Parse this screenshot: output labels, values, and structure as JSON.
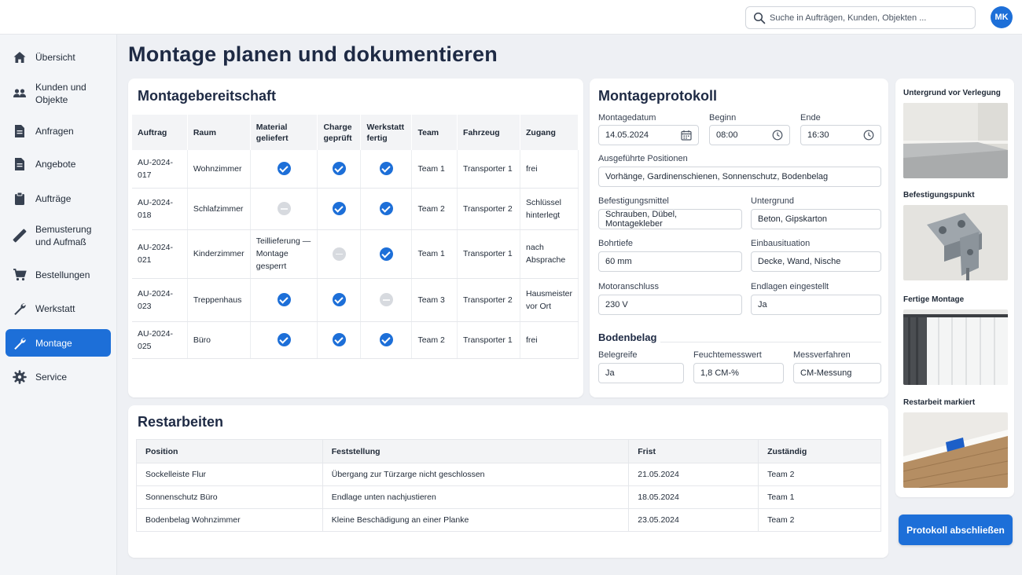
{
  "search": {
    "placeholder": "Suche in Aufträgen, Kunden, Objekten ..."
  },
  "user": {
    "initials": "MK"
  },
  "sidebar": {
    "items": [
      {
        "label": "Übersicht",
        "icon": "home-icon"
      },
      {
        "label": "Kunden und Objekte",
        "icon": "users-icon"
      },
      {
        "label": "Anfragen",
        "icon": "document-icon"
      },
      {
        "label": "Angebote",
        "icon": "document-icon"
      },
      {
        "label": "Aufträge",
        "icon": "clipboard-icon"
      },
      {
        "label": "Bemusterung und Aufmaß",
        "icon": "ruler-icon"
      },
      {
        "label": "Bestellungen",
        "icon": "cart-icon"
      },
      {
        "label": "Werkstatt",
        "icon": "wrench-icon"
      },
      {
        "label": "Montage",
        "icon": "wrench-icon",
        "active": true
      },
      {
        "label": "Service",
        "icon": "gear-icon"
      }
    ]
  },
  "page": {
    "title": "Montage planen und dokumentieren"
  },
  "readiness": {
    "title": "Montagebereitschaft",
    "columns": [
      "Auftrag",
      "Raum",
      "Material geliefert",
      "Charge geprüft",
      "Werkstatt fertig",
      "Team",
      "Fahrzeug",
      "Zugang"
    ],
    "rows": [
      {
        "auftrag": "AU-2024-017",
        "raum": "Wohnzimmer",
        "material": "check",
        "material_text": "",
        "charge": "check",
        "werkstatt": "check",
        "team": "Team 1",
        "fahrzeug": "Transporter 1",
        "zugang": "frei"
      },
      {
        "auftrag": "AU-2024-018",
        "raum": "Schlafzimmer",
        "material": "pending",
        "material_text": "",
        "charge": "check",
        "werkstatt": "check",
        "team": "Team 2",
        "fahrzeug": "Transporter 2",
        "zugang": "Schlüssel hinterlegt"
      },
      {
        "auftrag": "AU-2024-021",
        "raum": "Kinderzimmer",
        "material": "text",
        "material_text": "Teillieferung — Montage gesperrt",
        "charge": "pending",
        "werkstatt": "check",
        "team": "Team 1",
        "fahrzeug": "Transporter 1",
        "zugang": "nach Absprache"
      },
      {
        "auftrag": "AU-2024-023",
        "raum": "Treppenhaus",
        "material": "check",
        "material_text": "",
        "charge": "check",
        "werkstatt": "pending",
        "team": "Team 3",
        "fahrzeug": "Transporter 2",
        "zugang": "Hausmeister vor Ort"
      },
      {
        "auftrag": "AU-2024-025",
        "raum": "Büro",
        "material": "check",
        "material_text": "",
        "charge": "check",
        "werkstatt": "check",
        "team": "Team 2",
        "fahrzeug": "Transporter 1",
        "zugang": "frei"
      }
    ]
  },
  "protocol": {
    "title": "Montageprotokoll",
    "date_label": "Montagedatum",
    "date_value": "14.05.2024",
    "start_label": "Beginn",
    "start_value": "08:00",
    "end_label": "Ende",
    "end_value": "16:30",
    "positions_label": "Ausgeführte Positionen",
    "positions_value": "Vorhänge, Gardinenschienen, Sonnenschutz, Bodenbelag",
    "fastening_label": "Befestigungsmittel",
    "fastening_value": "Schrauben, Dübel, Montagekleber",
    "substrate_label": "Untergrund",
    "substrate_value": "Beton, Gipskarton",
    "depth_label": "Bohrtiefe",
    "depth_value": "60 mm",
    "installation_label": "Einbausituation",
    "installation_value": "Decke, Wand, Nische",
    "motor_label": "Motoranschluss",
    "motor_value": "230 V",
    "endpos_label": "Endlagen eingestellt",
    "endpos_value": "Ja",
    "floor": {
      "title": "Bodenbelag",
      "ready_label": "Belegreife",
      "ready_value": "Ja",
      "moisture_label": "Feuchtemesswert",
      "moisture_value": "1,8 CM-%",
      "method_label": "Messverfahren",
      "method_value": "CM-Messung"
    }
  },
  "photos": [
    {
      "label": "Untergrund vor Verlegung"
    },
    {
      "label": "Befestigungspunkt"
    },
    {
      "label": "Fertige Montage"
    },
    {
      "label": "Restarbeit markiert"
    }
  ],
  "rest": {
    "title": "Restarbeiten",
    "columns": [
      "Position",
      "Feststellung",
      "Frist",
      "Zuständig"
    ],
    "rows": [
      {
        "position": "Sockelleiste Flur",
        "finding": "Übergang zur Türzarge nicht geschlossen",
        "deadline": "21.05.2024",
        "owner": "Team 2"
      },
      {
        "position": "Sonnenschutz Büro",
        "finding": "Endlage unten nachjustieren",
        "deadline": "18.05.2024",
        "owner": "Team 1"
      },
      {
        "position": "Bodenbelag Wohnzimmer",
        "finding": "Kleine Beschädigung an einer Planke",
        "deadline": "23.05.2024",
        "owner": "Team 2"
      }
    ]
  },
  "actions": {
    "close_protocol": "Protokoll abschließen"
  },
  "colors": {
    "accent": "#1d6fd8",
    "title": "#1e2a44",
    "pending": "#d7dadf"
  }
}
